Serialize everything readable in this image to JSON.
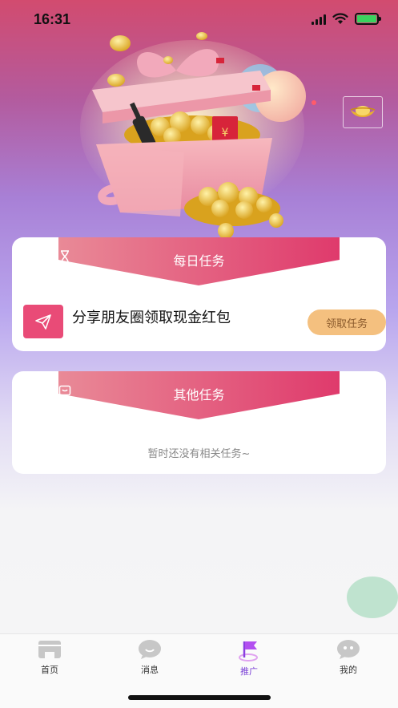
{
  "status_bar": {
    "time": "16:31"
  },
  "daily_tasks": {
    "title": "每日任务",
    "items": [
      {
        "title": "分享朋友圈领取现金红包",
        "action_label": "领取任务"
      }
    ]
  },
  "other_tasks": {
    "title": "其他任务",
    "empty_text": "暂时还没有相关任务~"
  },
  "tab_bar": {
    "items": [
      {
        "label": "首页",
        "icon": "shop-icon",
        "active": false
      },
      {
        "label": "消息",
        "icon": "message-icon",
        "active": false
      },
      {
        "label": "推广",
        "icon": "flag-icon",
        "active": true
      },
      {
        "label": "我的",
        "icon": "profile-icon",
        "active": false
      }
    ]
  },
  "colors": {
    "accent": "#e94b77",
    "task_button": "#f4c07f",
    "active_tab": "#7a3fd6"
  }
}
